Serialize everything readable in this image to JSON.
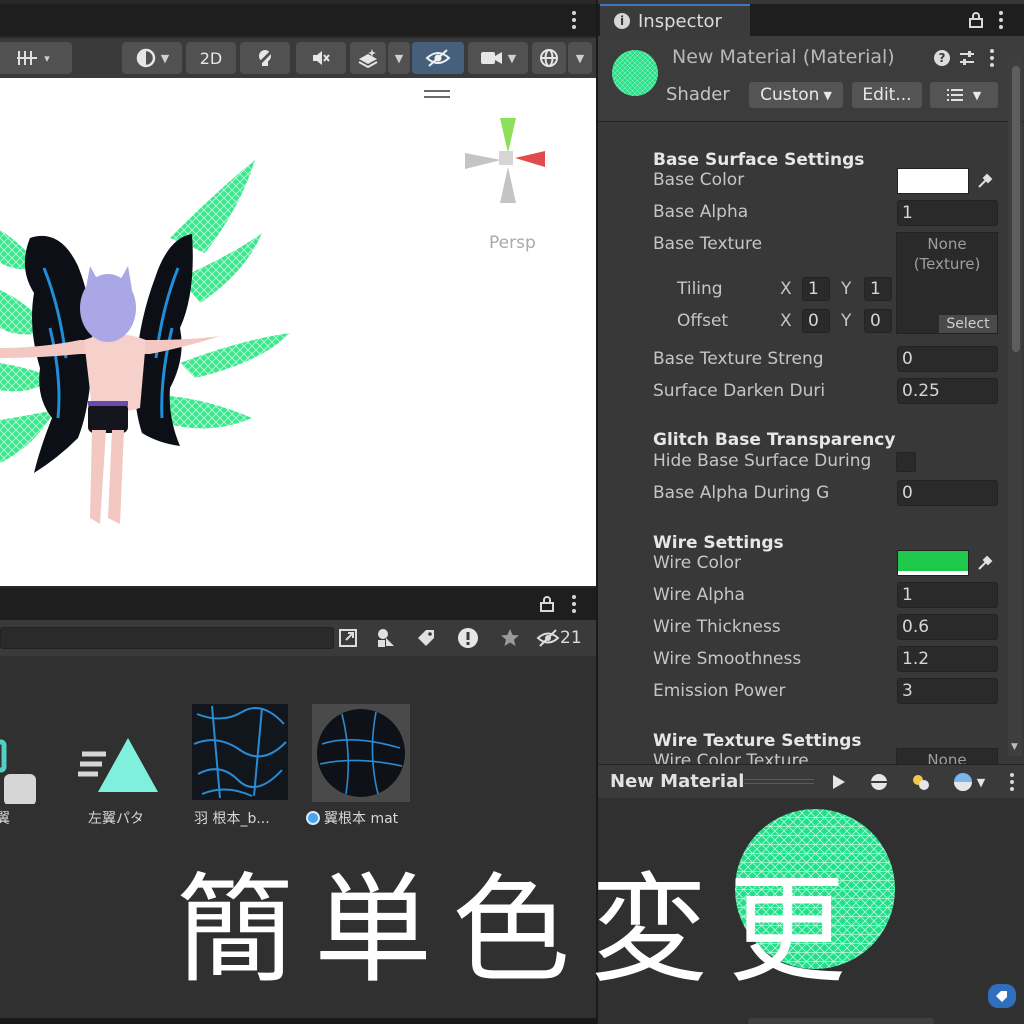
{
  "scene_view": {
    "toolbar": {
      "grid_caret": "▾",
      "mode_2d_label": "2D"
    },
    "persp_label": "Persp"
  },
  "project": {
    "hidden_count": "21",
    "assets": [
      {
        "label": "翼"
      },
      {
        "label": "左翼パタ"
      },
      {
        "label": "羽  根本_b..."
      },
      {
        "label": "翼根本  mat"
      }
    ]
  },
  "inspector": {
    "tab_label": "Inspector",
    "material_title": "New Material (Material)",
    "shader_label": "Shader",
    "shader_value": "Custon",
    "edit_button": "Edit...",
    "base_surface": {
      "title": "Base Surface Settings",
      "base_color_label": "Base Color",
      "base_color": "#ffffff",
      "base_alpha_label": "Base Alpha",
      "base_alpha": "1",
      "base_texture_label": "Base Texture",
      "texture_none_line1": "None",
      "texture_none_line2": "(Texture)",
      "select_label": "Select",
      "tiling_label": "Tiling",
      "tiling_x_label": "X",
      "tiling_x": "1",
      "tiling_y_label": "Y",
      "tiling_y": "1",
      "offset_label": "Offset",
      "offset_x_label": "X",
      "offset_x": "0",
      "offset_y_label": "Y",
      "offset_y": "0",
      "texture_strength_label": "Base Texture Streng",
      "texture_strength": "0",
      "surface_darken_label": "Surface Darken Duri",
      "surface_darken": "0.25"
    },
    "glitch": {
      "title": "Glitch Base Transparency",
      "hide_surface_label": "Hide Base Surface During",
      "alpha_during_label": "Base Alpha During G",
      "alpha_during": "0"
    },
    "wire": {
      "title": "Wire Settings",
      "wire_color_label": "Wire Color",
      "wire_color": "#1ec84a",
      "wire_alpha_label": "Wire Alpha",
      "wire_alpha": "1",
      "wire_thickness_label": "Wire Thickness",
      "wire_thickness": "0.6",
      "wire_smoothness_label": "Wire Smoothness",
      "wire_smoothness": "1.2",
      "emission_label": "Emission Power",
      "emission": "3"
    },
    "wire_texture": {
      "title": "Wire Texture Settings",
      "color_texture_label": "Wire Color Texture",
      "none_label": "None"
    }
  },
  "preview": {
    "title": "New Material"
  },
  "overlay": {
    "text": "簡単色変更"
  },
  "colors": {
    "wing_green": "#22e07a",
    "wing_dark": "#0e1218",
    "wing_blue": "#1e8fd8",
    "accent_blue": "#3a79bb"
  }
}
